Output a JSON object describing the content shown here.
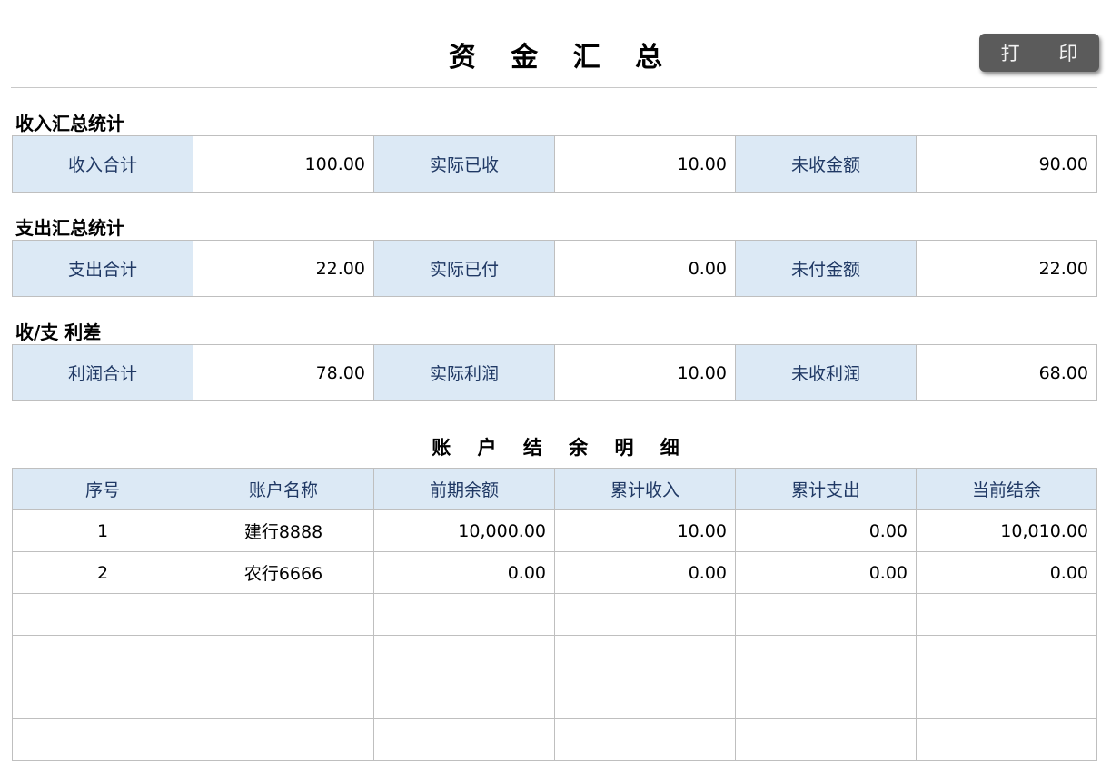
{
  "header": {
    "title": "资 金 汇 总",
    "print_label": "打 印"
  },
  "income": {
    "heading": "收入汇总统计",
    "total_label": "收入合计",
    "total_value": "100.00",
    "actual_label": "实际已收",
    "actual_value": "10.00",
    "pending_label": "未收金额",
    "pending_value": "90.00"
  },
  "expense": {
    "heading": "支出汇总统计",
    "total_label": "支出合计",
    "total_value": "22.00",
    "actual_label": "实际已付",
    "actual_value": "0.00",
    "pending_label": "未付金额",
    "pending_value": "22.00"
  },
  "profit": {
    "heading": "收/支 利差",
    "total_label": "利润合计",
    "total_value": "78.00",
    "actual_label": "实际利润",
    "actual_value": "10.00",
    "pending_label": "未收利润",
    "pending_value": "68.00"
  },
  "accounts": {
    "title": "账 户 结 余 明 细",
    "columns": [
      "序号",
      "账户名称",
      "前期余额",
      "累计收入",
      "累计支出",
      "当前结余"
    ],
    "rows": [
      [
        "1",
        "建行8888",
        "10,000.00",
        "10.00",
        "0.00",
        "10,010.00"
      ],
      [
        "2",
        "农行6666",
        "0.00",
        "0.00",
        "0.00",
        "0.00"
      ],
      [
        "",
        "",
        "",
        "",
        "",
        ""
      ],
      [
        "",
        "",
        "",
        "",
        "",
        ""
      ],
      [
        "",
        "",
        "",
        "",
        "",
        ""
      ],
      [
        "",
        "",
        "",
        "",
        "",
        ""
      ]
    ]
  },
  "colors": {
    "label_background": "#dce9f5",
    "label_text": "#1f3864",
    "button_background": "#5b5b5b",
    "grid_border": "#bfbfbf"
  }
}
